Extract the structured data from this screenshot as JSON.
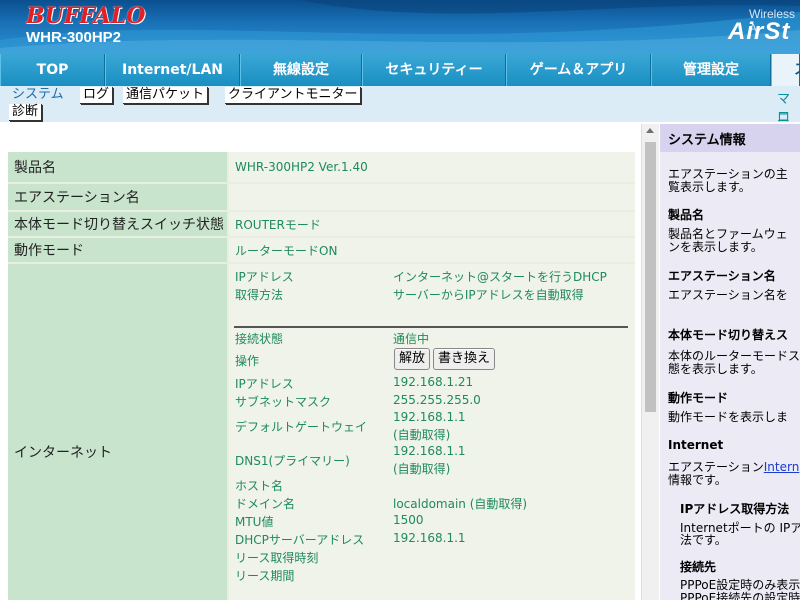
{
  "header": {
    "brand": "BUFFALO",
    "model": "WHR-300HP2",
    "wireless": "Wireless A",
    "airstation": "AirSt"
  },
  "nav": {
    "tabs": [
      {
        "label": "TOP"
      },
      {
        "label": "Internet/LAN"
      },
      {
        "label": "無線設定"
      },
      {
        "label": "セキュリティー"
      },
      {
        "label": "ゲーム＆アプリ"
      },
      {
        "label": "管理設定"
      },
      {
        "label": "ス"
      }
    ]
  },
  "subnav": {
    "items": [
      {
        "label": "システム"
      },
      {
        "label": "ログ"
      },
      {
        "label": "通信パケット"
      },
      {
        "label": "クライアントモニター"
      },
      {
        "label": "診断"
      }
    ],
    "right1": "マニ",
    "right2": "ログ"
  },
  "main": {
    "rows": [
      {
        "label": "製品名",
        "value": "WHR-300HP2 Ver.1.40"
      },
      {
        "label": "エアステーション名",
        "value": ""
      },
      {
        "label": "本体モード切り替えスイッチ状態",
        "value": "ROUTERモード"
      },
      {
        "label": "動作モード",
        "value": "ルーターモードON"
      }
    ],
    "internet": {
      "label": "インターネット",
      "ip_label": "IPアドレス",
      "ip_value": "インターネット@スタートを行うDHCP",
      "method_label": "取得方法",
      "method_value": "サーバーからIPアドレスを自動取得",
      "conn_label": "接続状態",
      "conn_value": "通信中",
      "op_label": "操作",
      "release_btn": "解放",
      "renew_btn": "書き換え",
      "ipaddr_label": "IPアドレス",
      "ipaddr_value": "192.168.1.21",
      "mask_label": "サブネットマスク",
      "mask_value": "255.255.255.0",
      "gw_label": "デフォルトゲートウェイ",
      "gw_value": "192.168.1.1",
      "gw_note": "(自動取得)",
      "dns_label": "DNS1(プライマリー)",
      "dns_value": "192.168.1.1",
      "dns_note": "(自動取得)",
      "host_label": "ホスト名",
      "domain_label": "ドメイン名",
      "domain_value": "localdomain (自動取得)",
      "mtu_label": "MTU値",
      "mtu_value": "1500",
      "dhcp_label": "DHCPサーバーアドレス",
      "dhcp_value": "192.168.1.1",
      "lease_get_label": "リース取得時刻",
      "lease_period_label": "リース期間"
    }
  },
  "help": {
    "title": "システム情報",
    "intro1": "エアステーションの主",
    "intro2": "覧表示します。",
    "s1_title": "製品名",
    "s1_l1": "製品名とファームウェ",
    "s1_l2": "ンを表示します。",
    "s2_title": "エアステーション名",
    "s2_l1": "エアステーション名を",
    "s3_title": "本体モード切り替えス",
    "s3_l1": "本体のルーターモードス",
    "s3_l2": "態を表示します。",
    "s4_title": "動作モード",
    "s4_l1": "動作モードを表示しま",
    "s5_title": "Internet",
    "s5_l1a": "エアステーション",
    "s5_l1b": "Intern",
    "s5_l2": "情報です。",
    "s6_title": "IPアドレス取得方法",
    "s6_l1": "Internetポートの IPア",
    "s6_l2": "法です。",
    "s7_title": "接続先",
    "s7_l1": "PPPoE設定時のみ表示",
    "s7_l2": "PPPoE接続先の設定時"
  }
}
